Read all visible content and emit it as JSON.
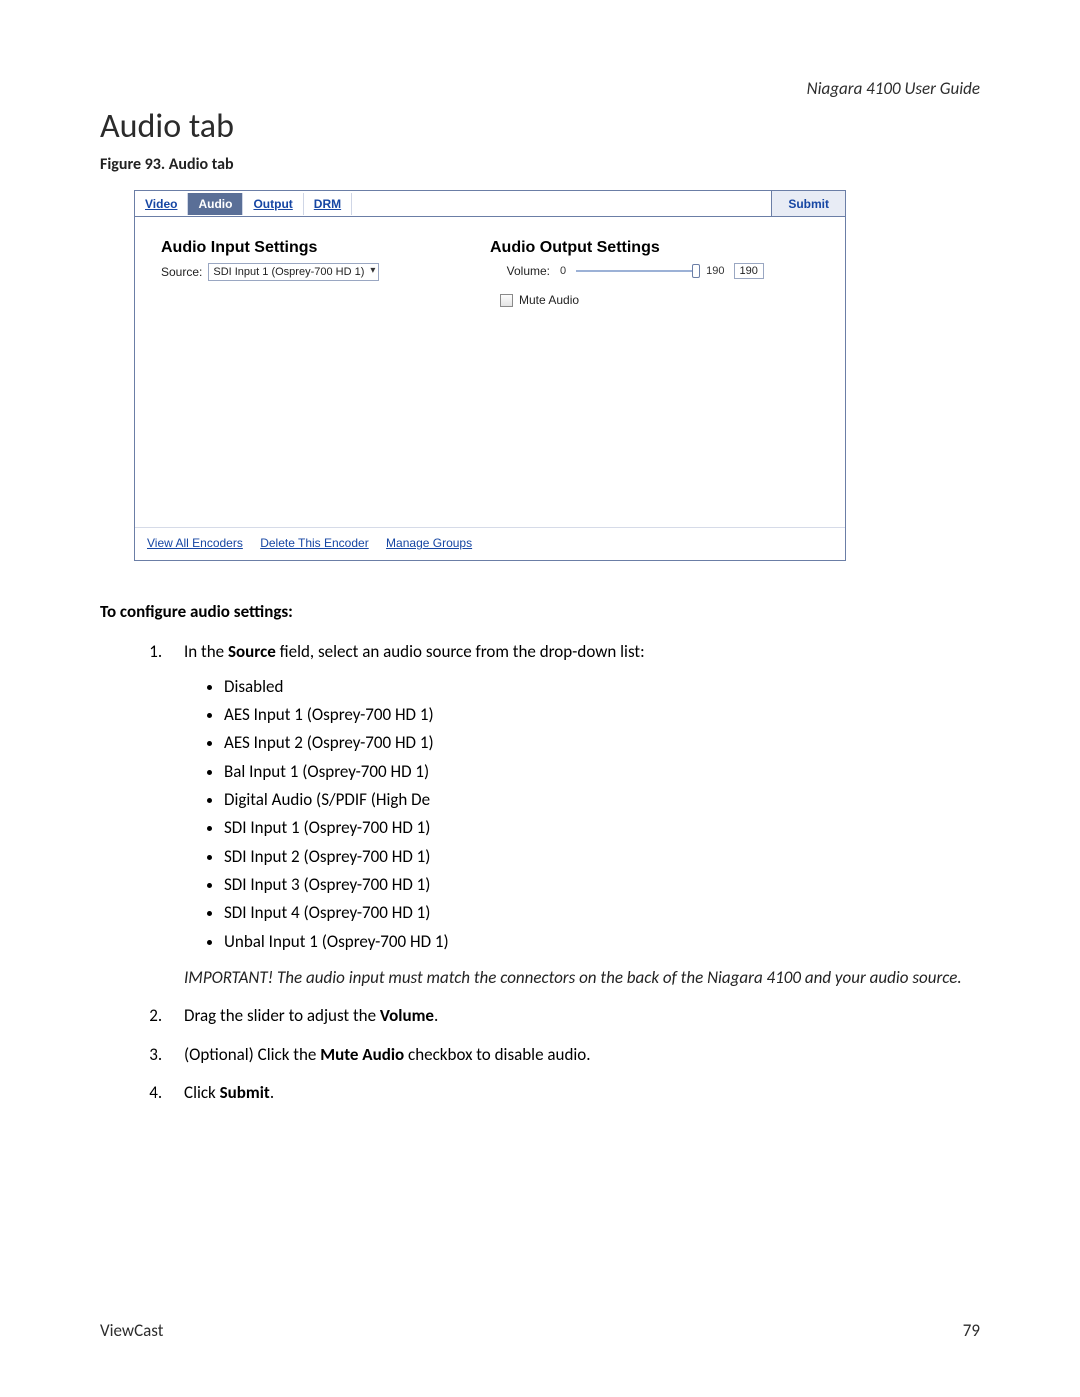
{
  "doc": {
    "header_right": "Niagara 4100 User Guide",
    "title": "Audio tab",
    "figure_caption": "Figure 93. Audio tab",
    "footer_left": "ViewCast",
    "footer_right": "79"
  },
  "panel": {
    "tabs": {
      "video": "Video",
      "audio": "Audio",
      "output": "Output",
      "drm": "DRM"
    },
    "submit": "Submit",
    "input_heading": "Audio Input Settings",
    "source_label": "Source:",
    "source_value": "SDI Input 1 (Osprey-700 HD 1)",
    "output_heading": "Audio Output Settings",
    "volume_label": "Volume:",
    "volume_min": "0",
    "volume_max": "190",
    "volume_value": "190",
    "mute_label": "Mute Audio",
    "footer_links": {
      "view_all": "View All Encoders",
      "delete": "Delete This Encoder",
      "manage": "Manage Groups"
    }
  },
  "instr": {
    "heading": "To configure audio settings:",
    "step1_pre": "In the ",
    "step1_bold": "Source",
    "step1_post": " field, select an audio source from the drop-down list:",
    "options": [
      "Disabled",
      "AES Input 1 (Osprey-700 HD 1)",
      "AES Input 2 (Osprey-700 HD 1)",
      "Bal Input 1 (Osprey-700 HD 1)",
      "Digital Audio (S/PDIF (High De",
      "SDI Input 1 (Osprey-700 HD 1)",
      "SDI Input 2 (Osprey-700 HD 1)",
      "SDI Input 3 (Osprey-700 HD 1)",
      "SDI Input 4 (Osprey-700 HD 1)",
      "Unbal Input 1 (Osprey-700 HD 1)"
    ],
    "important": "IMPORTANT! The audio input must match the connectors on the back of the Niagara 4100 and your audio source.",
    "step2_pre": "Drag the slider to adjust the ",
    "step2_bold": "Volume",
    "step2_post": ".",
    "step3_pre": "(Optional) Click the ",
    "step3_bold": "Mute Audio",
    "step3_post": " checkbox to disable audio.",
    "step4_pre": "Click ",
    "step4_bold": "Submit",
    "step4_post": "."
  }
}
